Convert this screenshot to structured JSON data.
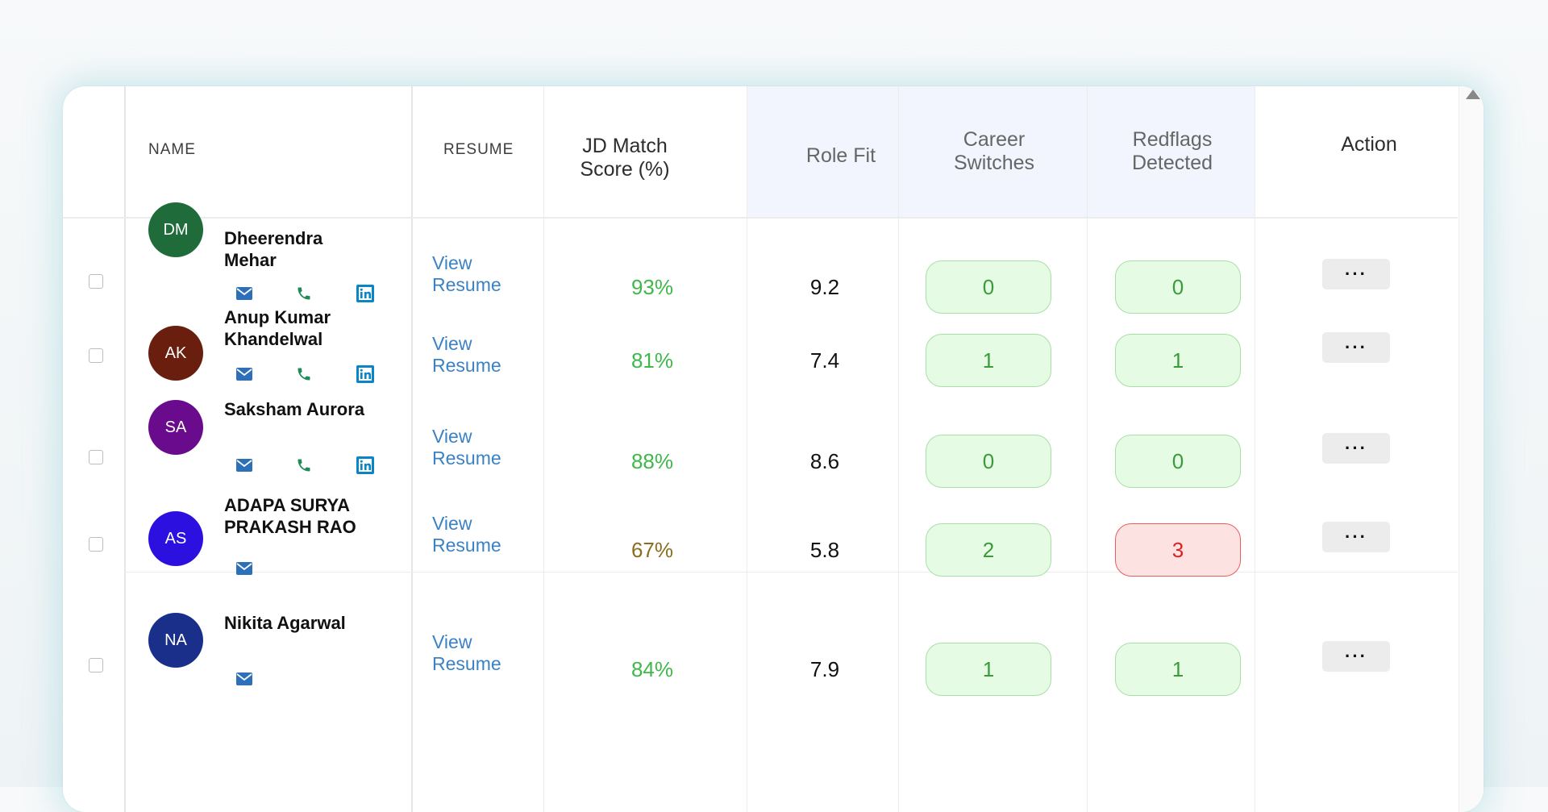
{
  "columns": {
    "name": "NAME",
    "resume": "RESUME",
    "jd_match": "JD Match Score (%)",
    "role_fit": "Role Fit",
    "career_switches": "Career Switches",
    "redflags": "Redflags Detected",
    "action": "Action"
  },
  "colors": {
    "green": "#3fb84a",
    "olive": "#8a6e1e",
    "link": "#3b82c4",
    "highlight_bg": "#f2f5fe"
  },
  "rows": [
    {
      "initials": "DM",
      "avatar_color": "#1f6b3a",
      "name": "Dheerendra Mehar",
      "contacts": [
        "email-icon",
        "phone-icon",
        "linkedin-icon"
      ],
      "resume_label": "View Resume",
      "score": "93%",
      "score_color": "#3fb84a",
      "role_fit": "9.2",
      "career_switches": "0",
      "redflags": "0",
      "redflag_alert": false,
      "action_label": "···"
    },
    {
      "initials": "AK",
      "avatar_color": "#6a1e0e",
      "name": "Anup Kumar Khandelwal",
      "contacts": [
        "email-icon",
        "phone-icon",
        "linkedin-icon"
      ],
      "resume_label": "View Resume",
      "score": "81%",
      "score_color": "#3fb84a",
      "role_fit": "7.4",
      "career_switches": "1",
      "redflags": "1",
      "redflag_alert": false,
      "action_label": "···"
    },
    {
      "initials": "SA",
      "avatar_color": "#6a0a8c",
      "name": "Saksham Aurora",
      "contacts": [
        "email-icon",
        "phone-icon",
        "linkedin-icon"
      ],
      "resume_label": "View Resume",
      "score": "88%",
      "score_color": "#3fb84a",
      "role_fit": "8.6",
      "career_switches": "0",
      "redflags": "0",
      "redflag_alert": false,
      "action_label": "···"
    },
    {
      "initials": "AS",
      "avatar_color": "#2c10e0",
      "name": "ADAPA SURYA PRAKASH RAO",
      "contacts": [
        "email-icon"
      ],
      "resume_label": "View Resume",
      "score": "67%",
      "score_color": "#8a6e1e",
      "role_fit": "5.8",
      "career_switches": "2",
      "redflags": "3",
      "redflag_alert": true,
      "action_label": "···"
    },
    {
      "initials": "NA",
      "avatar_color": "#1a2f8a",
      "name": "Nikita Agarwal",
      "contacts": [
        "email-icon"
      ],
      "resume_label": "View Resume",
      "score": "84%",
      "score_color": "#3fb84a",
      "role_fit": "7.9",
      "career_switches": "1",
      "redflags": "1",
      "redflag_alert": false,
      "action_label": "···"
    }
  ]
}
